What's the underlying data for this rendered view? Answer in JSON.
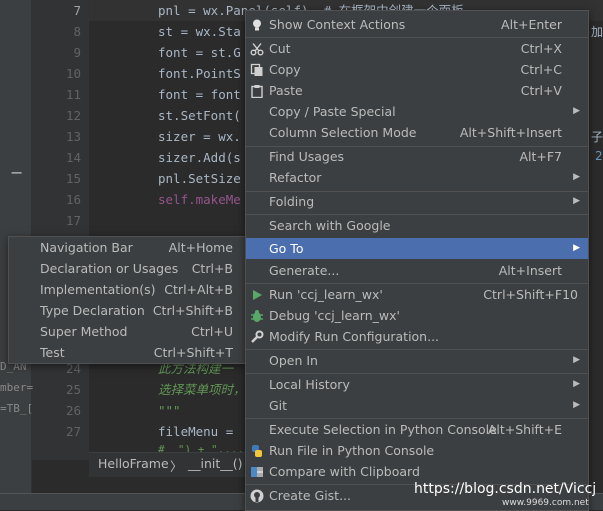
{
  "editor": {
    "line_numbers": [
      "7",
      "8",
      "9",
      "10",
      "11",
      "12",
      "13",
      "14",
      "15",
      "16",
      "17"
    ],
    "code_lines": [
      "pnl = wx.Panel(self)  # 在框架中创建一个面板",
      "st = wx.Sta",
      "font = st.G",
      "font.PointS",
      "font = font",
      "st.SetFont(",
      "sizer = wx.",
      "sizer.Add(s",
      "pnl.SetSize",
      "self.makeMe"
    ],
    "right_fragments": {
      "line8": "加",
      "line13": "子",
      "line14": "2"
    },
    "lower_line_numbers": [
      "24",
      "25",
      "26",
      "27"
    ],
    "lower_code": {
      "line24": "此方法构建一",
      "line25": "选择菜单项时，",
      "line26": "\"\"\"",
      "line27": "fileMenu = ",
      "line28": "#  \") + \"...."
    },
    "left_fragments": [
      "D_AN",
      "mber=",
      "=TB_["
    ],
    "breadcrumb": {
      "class_name": "HelloFrame",
      "sep": "〉",
      "method": "__init__()"
    }
  },
  "context_menu": {
    "items": [
      {
        "icon": "bulb-icon",
        "label": "Show Context Actions",
        "shortcut": "Alt+Enter"
      },
      {
        "sep": true
      },
      {
        "icon": "scissors-icon",
        "label": "Cut",
        "shortcut": "Ctrl+X"
      },
      {
        "icon": "copy-icon",
        "label": "Copy",
        "shortcut": "Ctrl+C"
      },
      {
        "icon": "paste-icon",
        "label": "Paste",
        "shortcut": "Ctrl+V"
      },
      {
        "label": "Copy / Paste Special",
        "submenu": true
      },
      {
        "label": "Column Selection Mode",
        "shortcut": "Alt+Shift+Insert"
      },
      {
        "sep": true
      },
      {
        "label": "Find Usages",
        "shortcut": "Alt+F7"
      },
      {
        "label": "Refactor",
        "submenu": true
      },
      {
        "sep": true
      },
      {
        "label": "Folding",
        "submenu": true
      },
      {
        "sep": true
      },
      {
        "label": "Search with Google"
      },
      {
        "label": "Go To",
        "submenu": true,
        "selected": true
      },
      {
        "label": "Generate...",
        "shortcut": "Alt+Insert"
      },
      {
        "sep": true
      },
      {
        "icon": "run-icon",
        "label": "Run 'ccj_learn_wx'",
        "shortcut": "Ctrl+Shift+F10"
      },
      {
        "icon": "debug-icon",
        "label": "Debug 'ccj_learn_wx'"
      },
      {
        "icon": "wrench-icon",
        "label": "Modify Run Configuration..."
      },
      {
        "sep": true
      },
      {
        "label": "Open In",
        "submenu": true
      },
      {
        "sep": true
      },
      {
        "label": "Local History",
        "submenu": true
      },
      {
        "label": "Git",
        "submenu": true
      },
      {
        "sep": true
      },
      {
        "label": "Execute Selection in Python Console",
        "shortcut": "Alt+Shift+E"
      },
      {
        "icon": "python-icon",
        "label": "Run File in Python Console"
      },
      {
        "icon": "compare-icon",
        "label": "Compare with Clipboard"
      },
      {
        "sep": true
      },
      {
        "icon": "github-icon",
        "label": "Create Gist..."
      }
    ]
  },
  "goto_submenu": {
    "items": [
      {
        "label": "Navigation Bar",
        "shortcut": "Alt+Home"
      },
      {
        "label": "Declaration or Usages",
        "shortcut": "Ctrl+B"
      },
      {
        "label": "Implementation(s)",
        "shortcut": "Ctrl+Alt+B"
      },
      {
        "label": "Type Declaration",
        "shortcut": "Ctrl+Shift+B"
      },
      {
        "label": "Super Method",
        "shortcut": "Ctrl+U"
      },
      {
        "label": "Test",
        "shortcut": "Ctrl+Shift+T"
      }
    ]
  },
  "watermark": {
    "text": "https://blog.csdn.net/Viccj",
    "sub": "www.9969.com.net"
  },
  "colors": {
    "menu_bg": "#3c3f41",
    "selected_bg": "#4b6eaf",
    "editor_bg": "#2b2b2b"
  }
}
